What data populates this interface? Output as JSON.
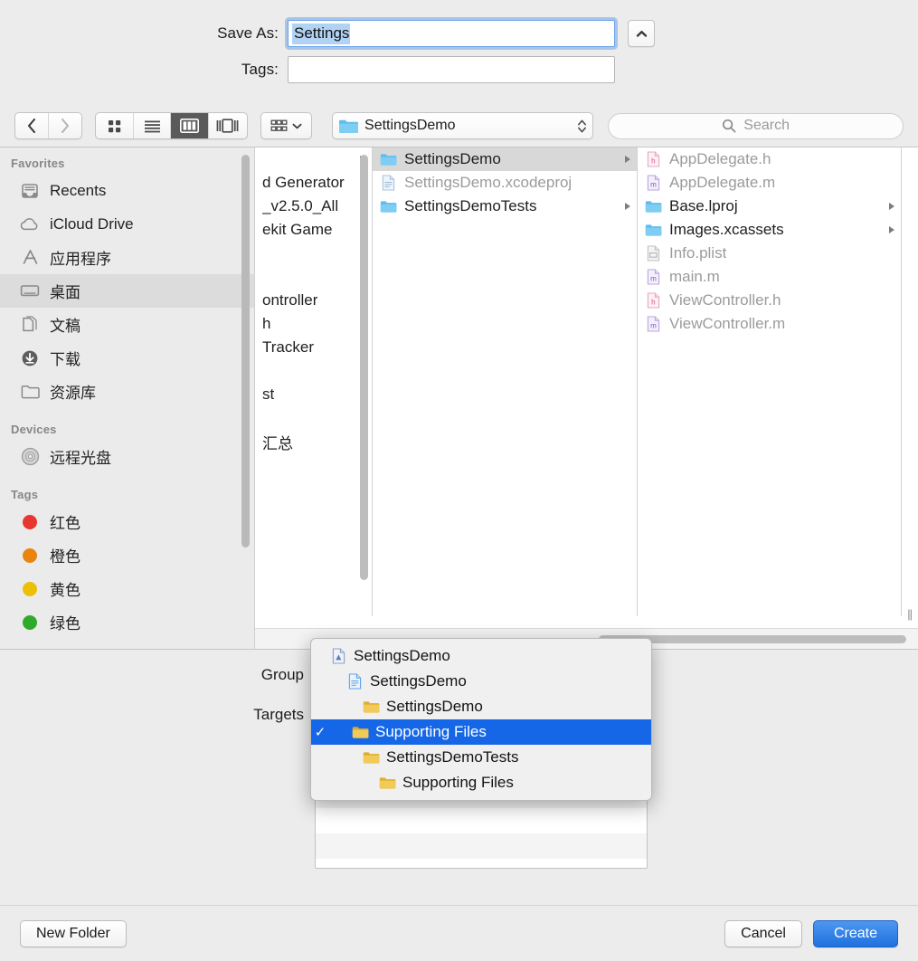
{
  "header": {
    "save_as_label": "Save As:",
    "save_as_value": "Settings",
    "tags_label": "Tags:",
    "tags_value": "",
    "disclosure_icon": "chevron-up-icon"
  },
  "toolbar": {
    "back_icon": "chevron-left-icon",
    "forward_icon": "chevron-right-icon",
    "view_icon_grid": "icon-view-icon",
    "view_list": "list-view-icon",
    "view_column": "column-view-icon",
    "view_gallery": "gallery-view-icon",
    "active_view": "column",
    "arrange_icon": "arrange-icon",
    "arrange_chevron": "chevron-down-icon",
    "path_label": "SettingsDemo",
    "path_icon": "folder-icon",
    "path_stepper_icon": "up-down-chevron-icon",
    "search_icon": "search-icon",
    "search_placeholder": "Search",
    "search_value": ""
  },
  "sidebar": {
    "sections": [
      {
        "title": "Favorites",
        "items": [
          {
            "label": "Recents",
            "icon": "recents-icon",
            "selected": false
          },
          {
            "label": "iCloud Drive",
            "icon": "cloud-icon",
            "selected": false
          },
          {
            "label": "应用程序",
            "icon": "applications-icon",
            "selected": false
          },
          {
            "label": "桌面",
            "icon": "desktop-icon",
            "selected": true
          },
          {
            "label": "文稿",
            "icon": "documents-icon",
            "selected": false
          },
          {
            "label": "下载",
            "icon": "downloads-icon",
            "selected": false
          },
          {
            "label": "资源库",
            "icon": "folder-icon",
            "selected": false
          }
        ]
      },
      {
        "title": "Devices",
        "items": [
          {
            "label": "远程光盘",
            "icon": "disc-icon",
            "selected": false
          }
        ]
      },
      {
        "title": "Tags",
        "items": [
          {
            "label": "红色",
            "icon": "tag-dot-icon",
            "color": "#e8372f",
            "selected": false
          },
          {
            "label": "橙色",
            "icon": "tag-dot-icon",
            "color": "#e98410",
            "selected": false
          },
          {
            "label": "黄色",
            "icon": "tag-dot-icon",
            "color": "#ecc007",
            "selected": false
          },
          {
            "label": "绿色",
            "icon": "tag-dot-icon",
            "color": "#2eab2a",
            "selected": false
          }
        ]
      }
    ]
  },
  "browser": {
    "column1": {
      "note_truncated": true,
      "rows": [
        {
          "label": "",
          "icon": "none",
          "arrow": true
        },
        {
          "label": "d Generator",
          "icon": "none",
          "arrow": true
        },
        {
          "label": "_v2.5.0_All",
          "icon": "none",
          "arrow": true
        },
        {
          "label": "ekit Game",
          "icon": "none",
          "arrow": true
        },
        {
          "label": "",
          "icon": "none",
          "arrow": true
        },
        {
          "label": "",
          "icon": "none",
          "arrow": true
        },
        {
          "label": "ontroller",
          "icon": "none",
          "arrow": true
        },
        {
          "label": "h",
          "icon": "none",
          "arrow": true
        },
        {
          "label": "Tracker",
          "icon": "none",
          "arrow": true
        },
        {
          "label": "",
          "icon": "none",
          "arrow": true
        },
        {
          "label": "st",
          "icon": "none",
          "arrow": true
        },
        {
          "label": "",
          "icon": "none",
          "arrow": true
        },
        {
          "label": "汇总",
          "icon": "none",
          "arrow": true
        },
        {
          "label": "",
          "icon": "none",
          "arrow": true
        },
        {
          "label": "",
          "icon": "none",
          "arrow": true
        },
        {
          "label": "",
          "icon": "none",
          "arrow": true
        },
        {
          "label": "",
          "icon": "none",
          "arrow": true
        },
        {
          "label": "",
          "icon": "none",
          "arrow": true
        }
      ]
    },
    "column2": {
      "rows": [
        {
          "label": "SettingsDemo",
          "icon": "folder-icon",
          "arrow": true,
          "selected": true,
          "dim": false
        },
        {
          "label": "SettingsDemo.xcodeproj",
          "icon": "document-icon",
          "arrow": false,
          "selected": false,
          "dim": true
        },
        {
          "label": "SettingsDemoTests",
          "icon": "folder-icon",
          "arrow": true,
          "selected": false,
          "dim": false
        }
      ]
    },
    "column3": {
      "rows": [
        {
          "label": "AppDelegate.h",
          "icon": "header-file-icon",
          "arrow": false,
          "dim": true
        },
        {
          "label": "AppDelegate.m",
          "icon": "source-file-icon",
          "arrow": false,
          "dim": true
        },
        {
          "label": "Base.lproj",
          "icon": "folder-icon",
          "arrow": true,
          "dim": false
        },
        {
          "label": "Images.xcassets",
          "icon": "folder-icon",
          "arrow": true,
          "dim": false
        },
        {
          "label": "Info.plist",
          "icon": "plist-file-icon",
          "arrow": false,
          "dim": true
        },
        {
          "label": "main.m",
          "icon": "source-file-icon",
          "arrow": false,
          "dim": true
        },
        {
          "label": "ViewController.h",
          "icon": "header-file-icon",
          "arrow": false,
          "dim": true
        },
        {
          "label": "ViewController.m",
          "icon": "source-file-icon",
          "arrow": false,
          "dim": true
        }
      ]
    },
    "resize_grip_icon": "resize-grip-icon"
  },
  "accessory": {
    "group_label": "Group",
    "group_value": "Supporting Files",
    "targets_label": "Targets"
  },
  "menu": {
    "items": [
      {
        "label": "SettingsDemo",
        "icon": "xcode-project-icon",
        "indent": 0,
        "checked": false,
        "selected": false
      },
      {
        "label": "SettingsDemo",
        "icon": "blue-document-icon",
        "indent": 1,
        "checked": false,
        "selected": false
      },
      {
        "label": "SettingsDemo",
        "icon": "yellow-folder-icon",
        "indent": 2,
        "checked": false,
        "selected": false
      },
      {
        "label": "Supporting Files",
        "icon": "yellow-folder-icon",
        "indent": 2,
        "checked": true,
        "selected": true
      },
      {
        "label": "SettingsDemoTests",
        "icon": "yellow-folder-icon",
        "indent": 2,
        "checked": false,
        "selected": false
      },
      {
        "label": "Supporting Files",
        "icon": "yellow-folder-icon",
        "indent": 3,
        "checked": false,
        "selected": false
      }
    ],
    "check_glyph": "✓"
  },
  "footer": {
    "new_folder_label": "New Folder",
    "cancel_label": "Cancel",
    "create_label": "Create"
  },
  "colors": {
    "accent_blue": "#1667e8",
    "default_button_blue": "#2f7ce6",
    "selection_highlight": "#b2d2f4",
    "folder_blue": "#6fc2f0",
    "folder_yellow": "#eec64a"
  }
}
